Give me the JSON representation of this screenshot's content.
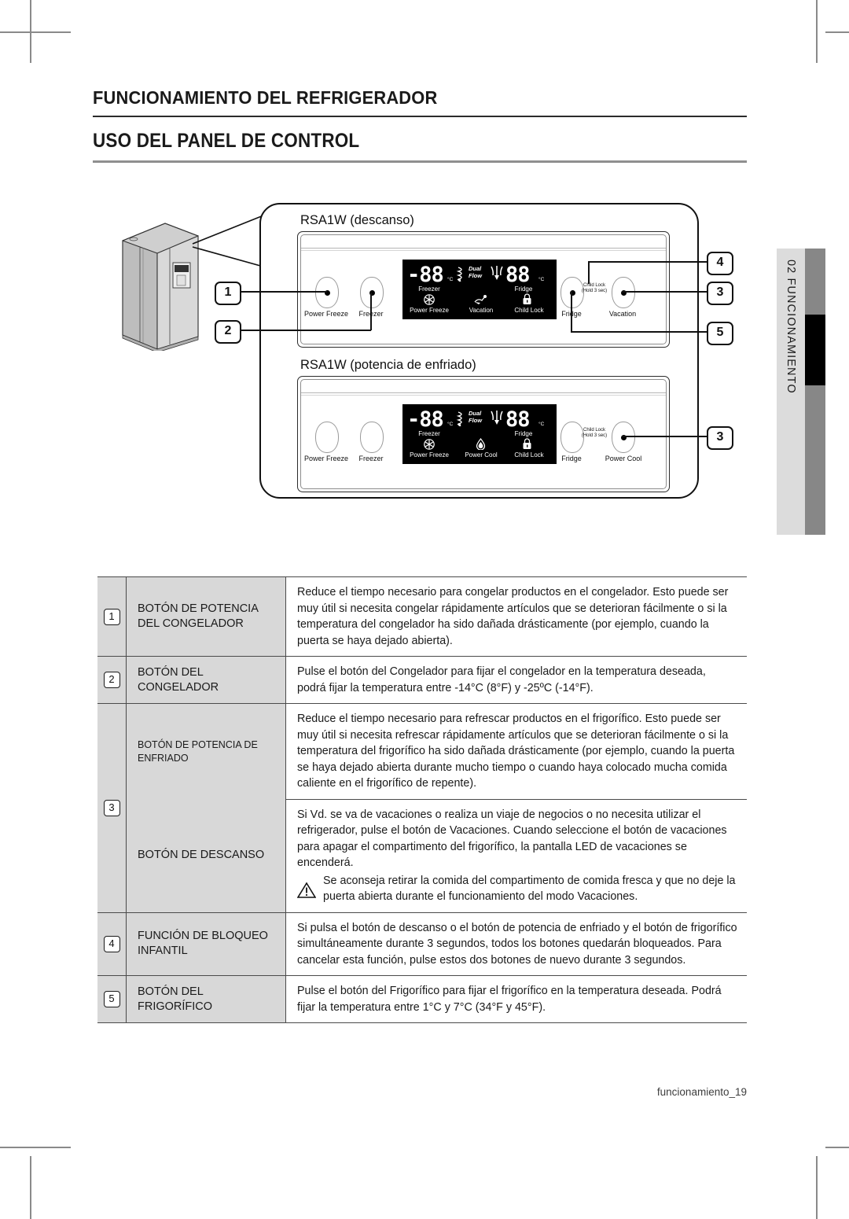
{
  "headings": {
    "chapter": "FUNCIONAMIENTO DEL REFRIGERADOR",
    "section": "USO DEL PANEL DE CONTROL"
  },
  "side_tab": {
    "label": "02 FUNCIONAMIENTO"
  },
  "footer": {
    "page": "funcionamiento_19"
  },
  "diagram": {
    "panels": [
      {
        "title": "RSA1W (descanso)",
        "buttons_left": [
          "Power Freeze",
          "Freezer"
        ],
        "buttons_right": [
          "Fridge",
          "Vacation"
        ],
        "child_lock_note": "Child Lock",
        "child_lock_hold": "(Hold 3 sec)",
        "display": {
          "freezer_value": "-88",
          "freezer_unit": "°C",
          "freezer_label": "Freezer",
          "dual_flow": "Dual Flow",
          "fridge_value": "88",
          "fridge_unit": "°C",
          "fridge_label": "Fridge",
          "indicators": [
            "Power Freeze",
            "Vacation",
            "Child Lock"
          ]
        },
        "callouts": [
          "1",
          "2",
          "4",
          "3",
          "5"
        ]
      },
      {
        "title": "RSA1W (potencia de enfriado)",
        "buttons_left": [
          "Power Freeze",
          "Freezer"
        ],
        "buttons_right": [
          "Fridge",
          "Power Cool"
        ],
        "child_lock_note": "Child Lock",
        "child_lock_hold": "(Hold 3 sec)",
        "display": {
          "freezer_value": "-88",
          "freezer_unit": "°C",
          "freezer_label": "Freezer",
          "dual_flow": "Dual Flow",
          "fridge_value": "88",
          "fridge_unit": "°C",
          "fridge_label": "Fridge",
          "indicators": [
            "Power Freeze",
            "Power Cool",
            "Child Lock"
          ]
        },
        "callouts": [
          "3"
        ]
      }
    ],
    "callout_labels": {
      "one": "1",
      "two": "2",
      "three": "3",
      "three_b": "3",
      "four": "4",
      "five": "5"
    }
  },
  "table": {
    "rows": [
      {
        "num": "1",
        "name": "BOTÓN DE POTENCIA DEL CONGELADOR",
        "desc": "Reduce el tiempo necesario para congelar productos en el congelador. Esto puede ser muy útil si necesita congelar rápidamente artículos que se deterioran fácilmente o si la temperatura del congelador ha sido dañada drásticamente (por ejemplo, cuando la puerta se haya dejado abierta)."
      },
      {
        "num": "2",
        "name": "BOTÓN DEL CONGELADOR",
        "desc": "Pulse el botón del Congelador para fijar el congelador en la temperatura deseada, podrá fijar la temperatura entre -14°C (8°F) y -25ºC (-14°F)."
      },
      {
        "num": "3",
        "name": "BOTÓN DE POTENCIA DE ENFRIADO",
        "desc": "Reduce el tiempo necesario para refrescar productos en el frigorífico. Esto puede ser muy útil si necesita refrescar rápidamente artículos que se deterioran fácilmente o si la temperatura del frigorífico ha sido dañada drásticamente (por ejemplo, cuando la puerta se haya dejado abierta durante mucho tiempo o cuando haya colocado mucha comida caliente en el frigorífico de repente)."
      },
      {
        "num": "",
        "name": "BOTÓN DE DESCANSO",
        "desc": "Si Vd. se va de vacaciones o realiza un viaje de negocios o no necesita utilizar el refrigerador, pulse el botón de Vacaciones. Cuando seleccione el botón de vacaciones para apagar el compartimento del frigorífico, la pantalla LED de vacaciones se encenderá.",
        "warning": "Se aconseja retirar la comida del compartimento de comida fresca y que no deje la puerta abierta durante el funcionamiento del modo Vacaciones."
      },
      {
        "num": "4",
        "name": "FUNCIÓN DE BLOQUEO INFANTIL",
        "desc": "Si pulsa el botón de descanso o el botón de potencia de enfriado y el botón de frigorífico simultáneamente durante 3 segundos, todos los botones quedarán bloqueados. Para cancelar esta función, pulse estos dos botones de nuevo durante 3 segundos."
      },
      {
        "num": "5",
        "name": "BOTÓN DEL FRIGORÍFICO",
        "desc": "Pulse el botón del Frigorífico para fijar el frigorífico en la temperatura deseada. Podrá fijar la temperatura entre 1°C y 7°C (34°F y 45°F)."
      }
    ]
  }
}
